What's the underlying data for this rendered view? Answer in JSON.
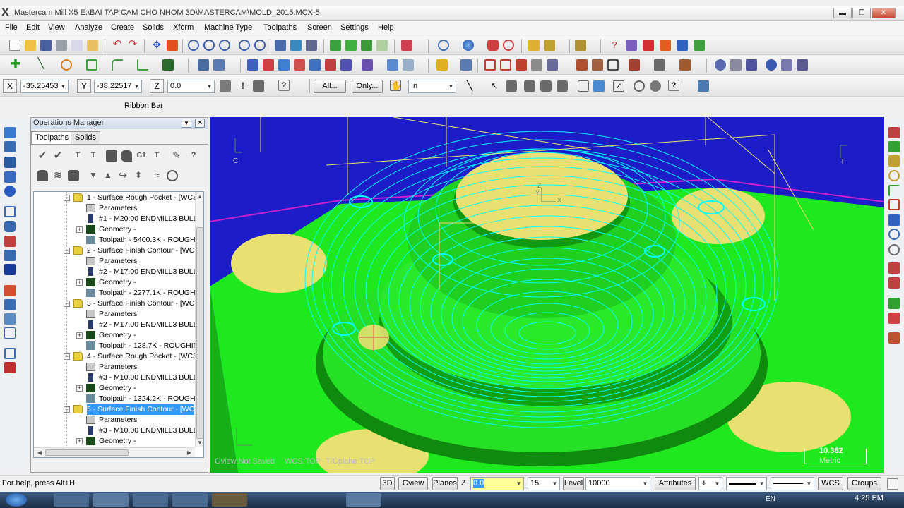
{
  "window": {
    "title": "Mastercam Mill X5  E:\\BAI TAP CAM CHO NHOM 3D\\MASTERCAM\\MOLD_2015.MCX-5",
    "logo": "X",
    "buttons": {
      "minimize": "▬",
      "restore": "❐",
      "close": "✕"
    }
  },
  "menu": [
    "File",
    "Edit",
    "View",
    "Analyze",
    "Create",
    "Solids",
    "Xform",
    "Machine Type",
    "Toolpaths",
    "Screen",
    "Settings",
    "Help"
  ],
  "ribbon": {
    "x_label": "X",
    "x_value": "-35.25453",
    "y_label": "Y",
    "y_value": "-38.22517",
    "z_label": "Z",
    "z_value": "0.0",
    "all_button": "All...",
    "only_button": "Only...",
    "mode_select": "In",
    "caption": "Ribbon Bar"
  },
  "ops": {
    "title": "Operations Manager",
    "tabs": [
      "Toolpaths",
      "Solids"
    ],
    "tree": [
      {
        "level": 0,
        "kind": "op",
        "text": "1 - Surface Rough Pocket - [WCS"
      },
      {
        "level": 1,
        "kind": "params",
        "text": "Parameters"
      },
      {
        "level": 1,
        "kind": "tool",
        "text": "#1 - M20.00 ENDMILL3 BULL"
      },
      {
        "level": 1,
        "kind": "geom",
        "text": "Geometry -"
      },
      {
        "level": 1,
        "kind": "path",
        "text": "Toolpath - 5400.3K - ROUGH"
      },
      {
        "level": 0,
        "kind": "op",
        "text": "2 - Surface Finish Contour - [WC"
      },
      {
        "level": 1,
        "kind": "params",
        "text": "Parameters"
      },
      {
        "level": 1,
        "kind": "tool",
        "text": "#2 - M17.00 ENDMILL3 BULL"
      },
      {
        "level": 1,
        "kind": "geom",
        "text": "Geometry -"
      },
      {
        "level": 1,
        "kind": "path",
        "text": "Toolpath - 2277.1K - ROUGH"
      },
      {
        "level": 0,
        "kind": "op",
        "text": "3 - Surface Finish Contour - [WC"
      },
      {
        "level": 1,
        "kind": "params",
        "text": "Parameters"
      },
      {
        "level": 1,
        "kind": "tool",
        "text": "#2 - M17.00 ENDMILL3 BULL"
      },
      {
        "level": 1,
        "kind": "geom",
        "text": "Geometry -"
      },
      {
        "level": 1,
        "kind": "path",
        "text": "Toolpath - 128.7K - ROUGHIN"
      },
      {
        "level": 0,
        "kind": "op",
        "text": "4 - Surface Rough Pocket - [WCS"
      },
      {
        "level": 1,
        "kind": "params",
        "text": "Parameters"
      },
      {
        "level": 1,
        "kind": "tool",
        "text": "#3 - M10.00 ENDMILL3 BULL"
      },
      {
        "level": 1,
        "kind": "geom",
        "text": "Geometry -"
      },
      {
        "level": 1,
        "kind": "path",
        "text": "Toolpath - 1324.2K - ROUGH"
      },
      {
        "level": 0,
        "kind": "op",
        "text": "5 - Surface Finish Contour - [WC",
        "selected": true
      },
      {
        "level": 1,
        "kind": "params",
        "text": "Parameters"
      },
      {
        "level": 1,
        "kind": "tool",
        "text": "#3 - M10.00 ENDMILL3 BULL"
      },
      {
        "level": 1,
        "kind": "geom",
        "text": "Geometry -"
      },
      {
        "level": 1,
        "kind": "path",
        "text": "Toolpath - 4163.3K - ROUGH"
      }
    ]
  },
  "viewport": {
    "axis_c": "C",
    "axis_t": "T",
    "axis_x": "X",
    "axis_y": "Y",
    "axis_z": "Z",
    "gview": "Gview:Not Saved",
    "wcs": "WCS:TOP",
    "tcplane": "T/Cplane:TOP",
    "scale_value": "10.362",
    "scale_unit": "Metric"
  },
  "statusbar": {
    "help": "For help, press Alt+H.",
    "btn_3d": "3D",
    "btn_gview": "Gview",
    "btn_planes": "Planes",
    "z_label": "Z",
    "z_value": "0.0",
    "color_value": "15",
    "level_label": "Level",
    "level_value": "10000",
    "attributes": "Attributes",
    "wcs": "WCS",
    "groups": "Groups"
  },
  "taskbar": {
    "clock": "4:25 PM",
    "lang": "EN"
  },
  "colors": {
    "viewport_bg": "#1c1cc8",
    "part_green": "#1ee81e",
    "toolpath_cyan": "#00ffff",
    "face_yellow": "#e8e070",
    "selection": "#3399ff"
  }
}
